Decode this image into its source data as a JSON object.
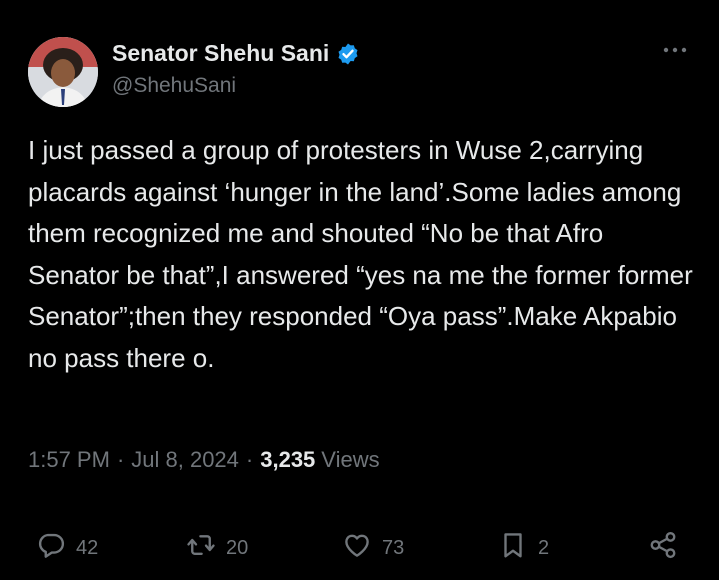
{
  "author": {
    "display_name": "Senator Shehu Sani",
    "handle": "@ShehuSani",
    "verified_color": "#1d9bf0"
  },
  "post": {
    "text": "I just passed a group of protesters in Wuse 2,carrying placards against ‘hunger in the land’.Some ladies among them recognized me and shouted “No be that Afro Senator be that”,I answered “yes na me the former former Senator”;then they responded “Oya pass”.Make Akpabio no pass there o.",
    "time": "1:57 PM",
    "date": "Jul 8, 2024",
    "separator": "·",
    "views_count": "3,235",
    "views_label": "Views"
  },
  "actions": {
    "replies": "42",
    "reposts": "20",
    "likes": "73",
    "bookmarks": "2"
  },
  "icons": {
    "more": "more-horizontal-icon",
    "reply": "reply-bubble-icon",
    "repost": "repost-arrows-icon",
    "like": "heart-icon",
    "bookmark": "bookmark-icon",
    "share": "share-nodes-icon",
    "verified": "verified-badge-icon"
  },
  "colors": {
    "background": "#000000",
    "text_primary": "#e7e9ea",
    "text_secondary": "#71767b",
    "accent": "#1d9bf0"
  }
}
